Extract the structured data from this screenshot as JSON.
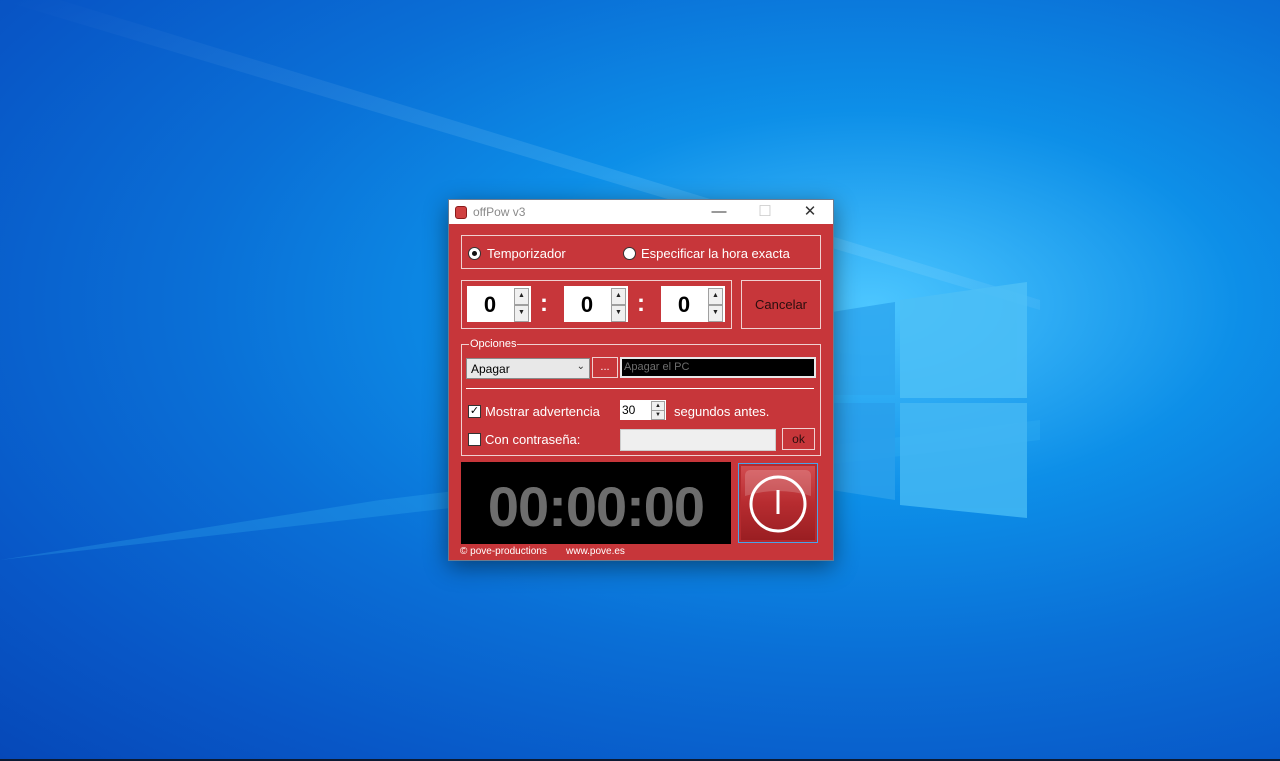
{
  "window": {
    "title": "offPow  v3",
    "minimize_icon": "—",
    "maximize_icon": "☐",
    "close_icon": "✕"
  },
  "mode": {
    "timer_label": "Temporizador",
    "exact_time_label": "Especificar la hora exacta",
    "selected": "timer"
  },
  "time": {
    "hours": "0",
    "minutes": "0",
    "seconds": "0",
    "separator": ":",
    "up_arrow": "▲",
    "down_arrow": "▼",
    "cancel_label": "Cancelar"
  },
  "options": {
    "legend": "Opciones",
    "action_value": "Apagar",
    "dropdown_arrow": "⌄",
    "browse_label": "...",
    "command_placeholder": "Apagar el PC",
    "warning_label": "Mostrar advertencia",
    "warning_checked": true,
    "warning_seconds": "30",
    "warning_suffix": "segundos antes.",
    "password_label": "Con contraseña:",
    "password_checked": false,
    "ok_label": "ok",
    "check_mark": "✓"
  },
  "display": {
    "countdown": "00:00:00"
  },
  "footer": {
    "copyright": "© pove-productions",
    "website": "www.pove.es"
  },
  "colors": {
    "window_bg": "#c7363a",
    "accent_border": "#4aa3e8",
    "clock_text": "#6d6d6d"
  }
}
